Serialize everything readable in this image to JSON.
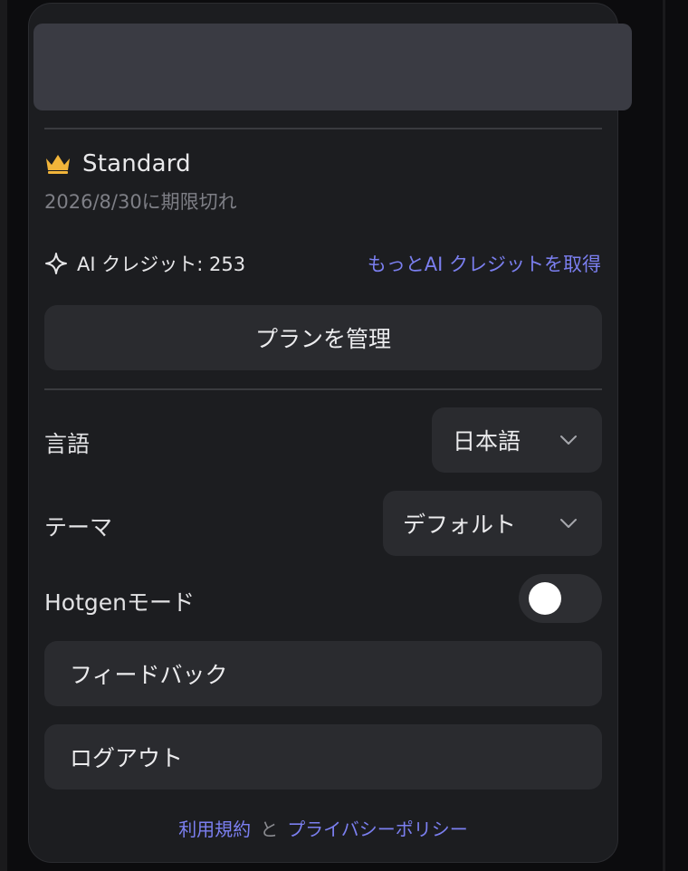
{
  "plan": {
    "name": "Standard",
    "expiry": "2026/8/30に期限切れ"
  },
  "credits": {
    "label": "AI クレジット: 253",
    "get_more": "もっとAI クレジットを取得"
  },
  "manage_plan_label": "プランを管理",
  "settings": {
    "language": {
      "label": "言語",
      "value": "日本語"
    },
    "theme": {
      "label": "テーマ",
      "value": "デフォルト"
    },
    "hotgen": {
      "label": "Hotgenモード",
      "enabled": false
    }
  },
  "feedback_label": "フィードバック",
  "logout_label": "ログアウト",
  "footer": {
    "terms": "利用規約",
    "and": "と",
    "privacy": "プライバシーポリシー"
  },
  "colors": {
    "accent": "#7b7ff0",
    "crown": "#f2b53a",
    "panel": "#1c1d20"
  }
}
